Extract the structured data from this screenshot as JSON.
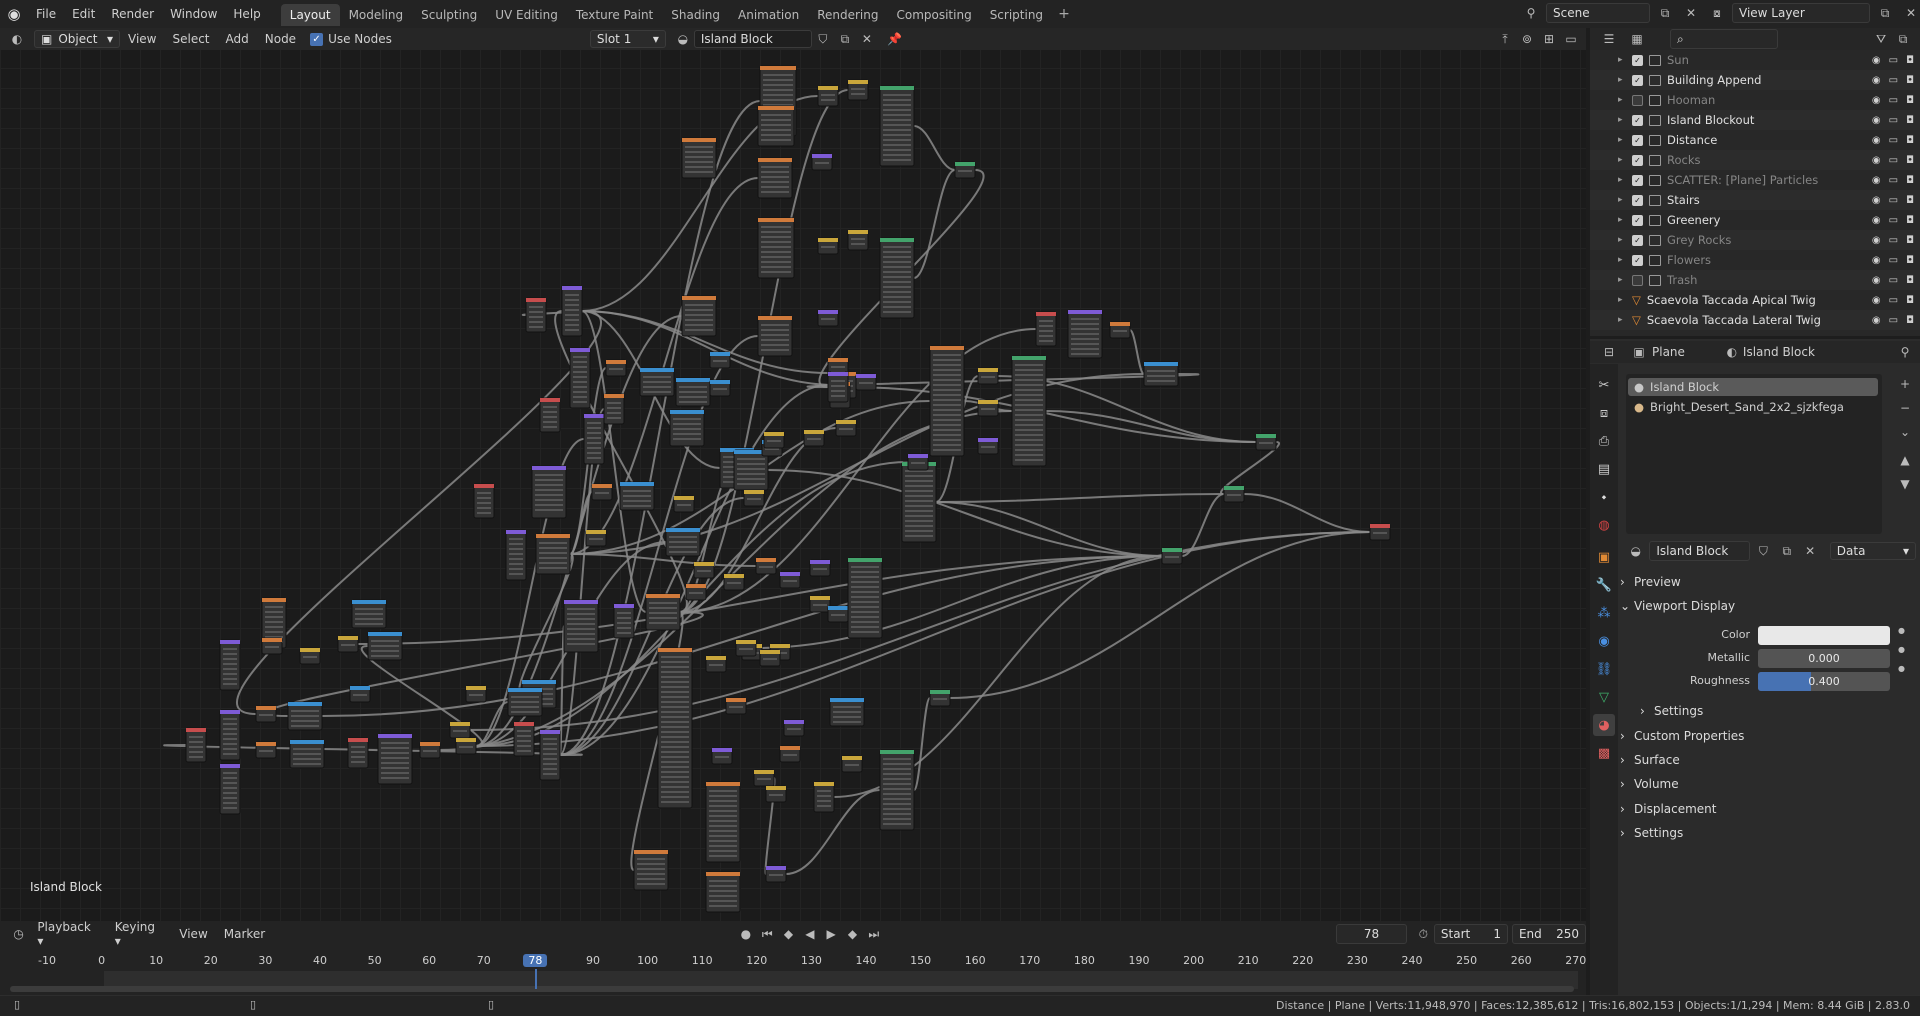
{
  "top_menu": {
    "items": [
      "File",
      "Edit",
      "Render",
      "Window",
      "Help"
    ]
  },
  "workspaces": {
    "tabs": [
      "Layout",
      "Modeling",
      "Sculpting",
      "UV Editing",
      "Texture Paint",
      "Shading",
      "Animation",
      "Rendering",
      "Compositing",
      "Scripting"
    ],
    "active": "Layout",
    "add": "+"
  },
  "scene": {
    "name": "Scene",
    "view_layer": "View Layer"
  },
  "node_header": {
    "mode": "Object",
    "view": "View",
    "select": "Select",
    "add": "Add",
    "node": "Node",
    "use_nodes_label": "Use Nodes",
    "use_nodes": true,
    "slot": "Slot 1",
    "material": "Island Block"
  },
  "editor_label": "Island Block",
  "outliner": {
    "search_placeholder": "",
    "rows": [
      {
        "name": "Sun",
        "checked": true,
        "dim": true
      },
      {
        "name": "Building Append",
        "checked": true,
        "dim": false
      },
      {
        "name": "Hooman",
        "checked": false,
        "dim": true
      },
      {
        "name": "Island Blockout",
        "checked": true,
        "dim": false
      },
      {
        "name": "Distance",
        "checked": true,
        "dim": false
      },
      {
        "name": "Rocks",
        "checked": true,
        "dim": true
      },
      {
        "name": "SCATTER: [Plane] Particles",
        "checked": true,
        "dim": true
      },
      {
        "name": "Stairs",
        "checked": true,
        "dim": false
      },
      {
        "name": "Greenery",
        "checked": true,
        "dim": false
      },
      {
        "name": "Grey Rocks",
        "checked": true,
        "dim": true
      },
      {
        "name": "Flowers",
        "checked": true,
        "dim": true
      },
      {
        "name": "Trash",
        "checked": false,
        "dim": true
      },
      {
        "name": "Scaevola Taccada Apical Twig",
        "checked": null,
        "dim": false
      },
      {
        "name": "Scaevola Taccada Lateral Twig",
        "checked": null,
        "dim": false
      }
    ]
  },
  "properties": {
    "breadcrumb_object": "Plane",
    "breadcrumb_material": "Island Block",
    "slots": [
      "Island Block",
      "Bright_Desert_Sand_2x2_sjzkfega"
    ],
    "material_name": "Island Block",
    "link": "Data",
    "panels": {
      "preview": "Preview",
      "viewport_display": "Viewport Display",
      "color_label": "Color",
      "metallic_label": "Metallic",
      "metallic": "0.000",
      "roughness_label": "Roughness",
      "roughness": "0.400",
      "roughness_fraction": 0.4,
      "settings_sub": "Settings",
      "custom_properties": "Custom Properties",
      "surface": "Surface",
      "volume": "Volume",
      "displacement": "Displacement",
      "settings": "Settings"
    }
  },
  "timeline": {
    "playback": "Playback",
    "keying": "Keying",
    "view": "View",
    "marker": "Marker",
    "current_frame": "78",
    "start_label": "Start",
    "start": "1",
    "end_label": "End",
    "end": "250",
    "ruler": [
      "-10",
      "0",
      "10",
      "20",
      "30",
      "40",
      "50",
      "60",
      "70",
      "78",
      "90",
      "100",
      "110",
      "120",
      "130",
      "140",
      "150",
      "160",
      "170",
      "180",
      "190",
      "200",
      "210",
      "220",
      "230",
      "240",
      "250",
      "260",
      "270"
    ]
  },
  "status": {
    "text": "Distance | Plane | Verts:11,948,970 | Faces:12,385,612 | Tris:16,802,153 | Objects:1/1,294 | Mem: 8.44 GiB | 2.83.0"
  },
  "colors": {
    "accent": "#4772b3",
    "node_input": "#c74d4d",
    "node_texture": "#d07a3b",
    "node_shader": "#43a36b",
    "node_vector": "#7e5bd6",
    "node_converter": "#3a8fd0",
    "node_color": "#c9a63b"
  }
}
